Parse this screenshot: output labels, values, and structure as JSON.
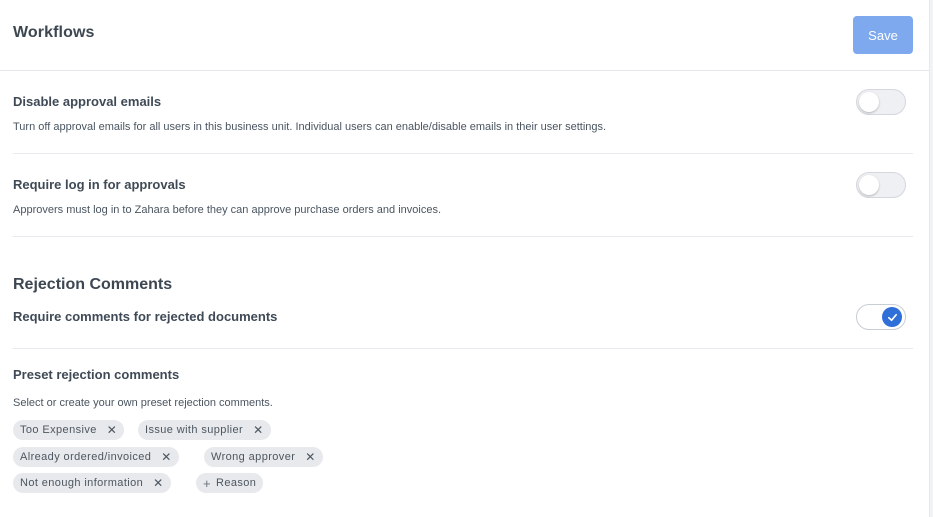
{
  "header": {
    "title": "Workflows",
    "save_label": "Save"
  },
  "settings": [
    {
      "title": "Disable approval emails",
      "description": "Turn off approval emails for all users in this business unit. Individual users can enable/disable emails in their user settings.",
      "enabled": false
    },
    {
      "title": "Require log in for approvals",
      "description": "Approvers must log in to Zahara before they can approve purchase orders and invoices.",
      "enabled": false
    }
  ],
  "rejection": {
    "section_title": "Rejection Comments",
    "require_label": "Require comments for rejected documents",
    "require_enabled": true,
    "preset_title": "Preset rejection comments",
    "preset_desc": "Select or create your own preset rejection comments.",
    "chips": [
      "Too Expensive",
      "Issue with supplier",
      "Already ordered/invoiced",
      "Wrong approver",
      "Not enough information"
    ],
    "add_label": "Reason"
  },
  "icons": {
    "remove": "close-icon",
    "add": "plus-icon",
    "check": "check-icon"
  },
  "colors": {
    "accent": "#2f6fd8",
    "save_button": "#7fa9ee"
  }
}
